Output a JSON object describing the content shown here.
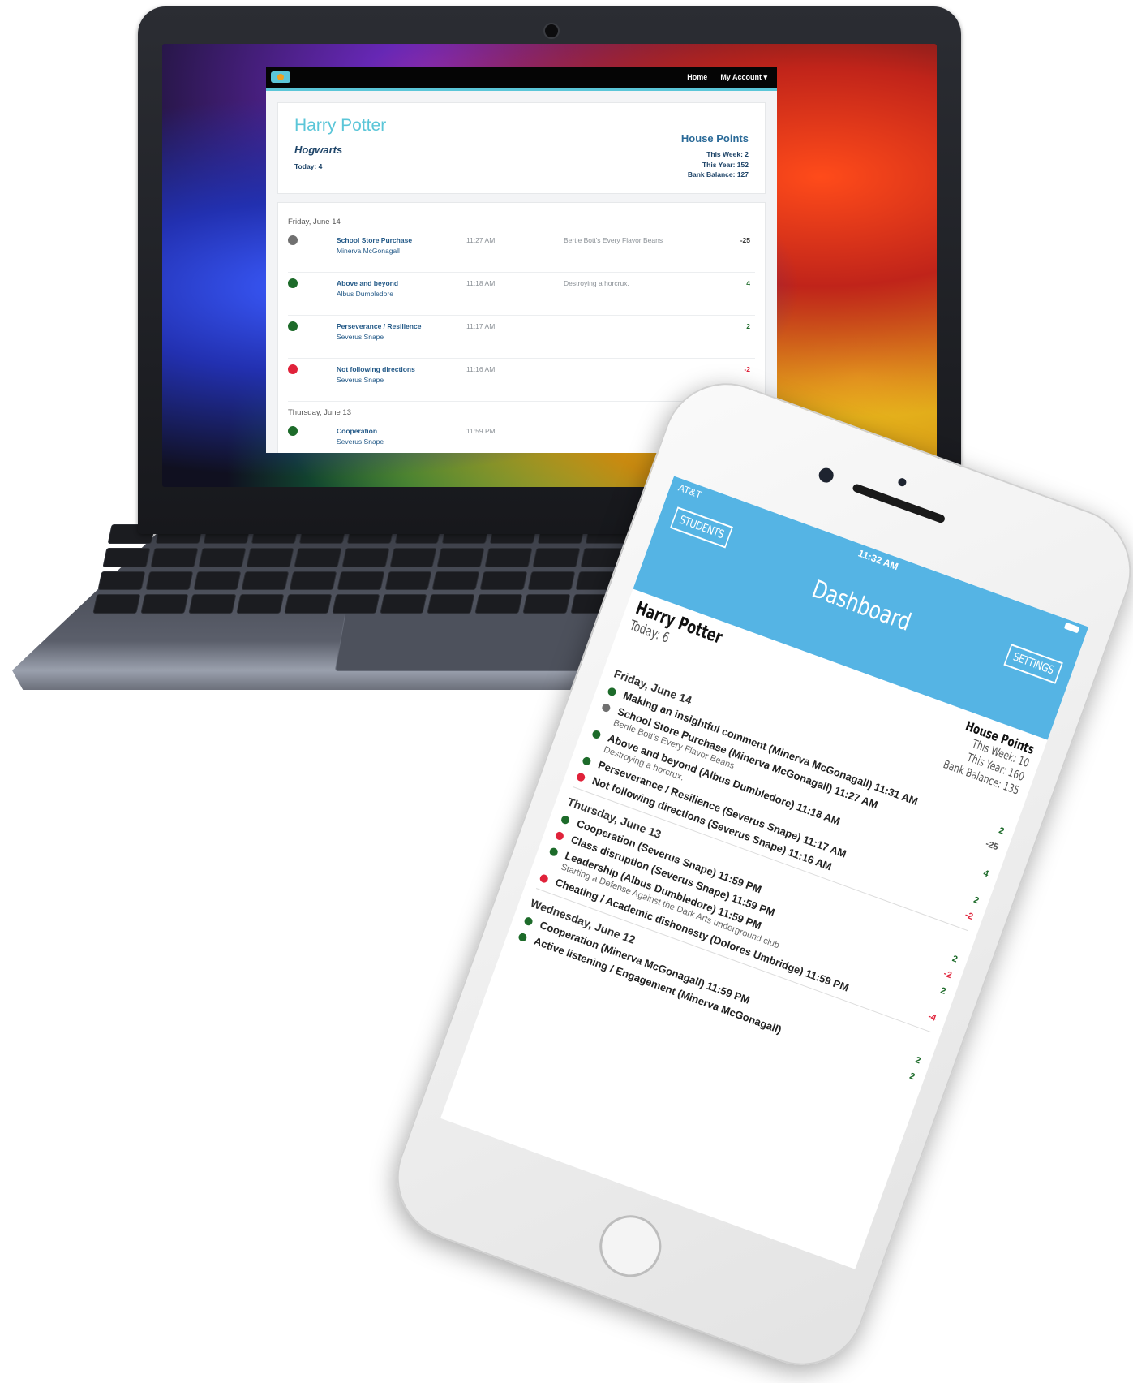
{
  "colors": {
    "accent": "#5bc6d8",
    "positive": "#1d6b2a",
    "negative": "#e0223a",
    "neutral": "#707070",
    "phone_header": "#55b4e4"
  },
  "web": {
    "nav": {
      "home": "Home",
      "my_account": "My Account ▾"
    },
    "student": {
      "name": "Harry Potter",
      "school": "Hogwarts",
      "today": "Today: 4"
    },
    "house_points": {
      "title": "House Points",
      "week": "This Week: 2",
      "year": "This Year: 152",
      "bank": "Bank Balance: 127"
    },
    "days": [
      {
        "date": "Friday, June 14",
        "entries": [
          {
            "status": "neutral",
            "behavior": "School Store Purchase",
            "teacher": "Minerva McGonagall",
            "time": "11:27 AM",
            "note": "Bertie Bott's Every Flavor Beans",
            "points": "-25"
          },
          {
            "status": "positive",
            "behavior": "Above and beyond",
            "teacher": "Albus Dumbledore",
            "time": "11:18 AM",
            "note": "Destroying a horcrux.",
            "points": "4"
          },
          {
            "status": "positive",
            "behavior": "Perseverance / Resilience",
            "teacher": "Severus Snape",
            "time": "11:17 AM",
            "note": "",
            "points": "2"
          },
          {
            "status": "negative",
            "behavior": "Not following directions",
            "teacher": "Severus Snape",
            "time": "11:16 AM",
            "note": "",
            "points": "-2"
          }
        ]
      },
      {
        "date": "Thursday, June 13",
        "entries": [
          {
            "status": "positive",
            "behavior": "Cooperation",
            "teacher": "Severus Snape",
            "time": "11:59 PM",
            "note": "",
            "points": ""
          }
        ]
      }
    ]
  },
  "phone": {
    "carrier": "AT&T",
    "clock": "11:32 AM",
    "students_btn": "STUDENTS",
    "settings_btn": "SETTINGS",
    "title": "Dashboard",
    "student_name": "Harry Potter",
    "today": "Today: 6",
    "house_points": {
      "title": "House Points",
      "week": "This Week: 10",
      "year": "This Year: 160",
      "bank": "Bank Balance: 135"
    },
    "days": [
      {
        "date": "Friday, June 14",
        "entries": [
          {
            "status": "positive",
            "text": "Making an insightful comment (Minerva McGonagall) 11:31 AM",
            "note": "",
            "points": "2"
          },
          {
            "status": "neutral",
            "text": "School Store Purchase (Minerva McGonagall) 11:27 AM",
            "note": "Bertie Bott's Every Flavor Beans",
            "points": "-25"
          },
          {
            "status": "positive",
            "text": "Above and beyond (Albus Dumbledore) 11:18 AM",
            "note": "Destroying a horcrux.",
            "points": "4"
          },
          {
            "status": "positive",
            "text": "Perseverance / Resilience (Severus Snape) 11:17 AM",
            "note": "",
            "points": "2"
          },
          {
            "status": "negative",
            "text": "Not following directions (Severus Snape) 11:16 AM",
            "note": "",
            "points": "-2"
          }
        ]
      },
      {
        "date": "Thursday, June 13",
        "entries": [
          {
            "status": "positive",
            "text": "Cooperation (Severus Snape) 11:59 PM",
            "note": "",
            "points": "2"
          },
          {
            "status": "negative",
            "text": "Class disruption (Severus Snape) 11:59 PM",
            "note": "",
            "points": "-2"
          },
          {
            "status": "positive",
            "text": "Leadership (Albus Dumbledore) 11:59 PM",
            "note": "Starting a Defense Against the Dark Arts underground club",
            "points": "2"
          },
          {
            "status": "negative",
            "text": "Cheating / Academic dishonesty (Dolores Umbridge) 11:59 PM",
            "note": "",
            "points": "-4"
          }
        ]
      },
      {
        "date": "Wednesday, June 12",
        "entries": [
          {
            "status": "positive",
            "text": "Cooperation (Minerva McGonagall) 11:59 PM",
            "note": "",
            "points": "2"
          },
          {
            "status": "positive",
            "text": "Active listening / Engagement (Minerva McGonagall)",
            "note": "",
            "points": "2"
          }
        ]
      }
    ]
  }
}
